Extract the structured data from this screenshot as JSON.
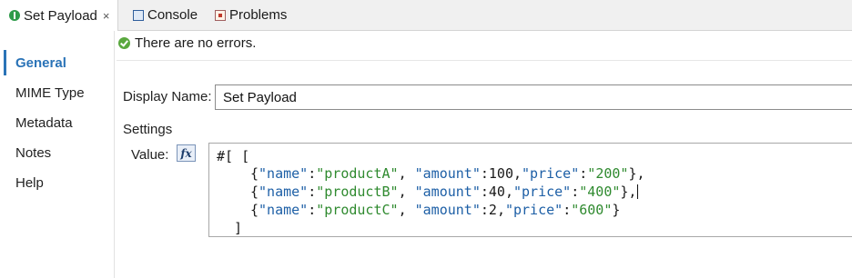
{
  "tabs": [
    {
      "label": "Set Payload",
      "active": true
    },
    {
      "label": "Console"
    },
    {
      "label": "Problems"
    }
  ],
  "close_glyph": "×",
  "sidebar": {
    "items": [
      {
        "label": "General",
        "active": true
      },
      {
        "label": "MIME Type"
      },
      {
        "label": "Metadata"
      },
      {
        "label": "Notes"
      },
      {
        "label": "Help"
      }
    ]
  },
  "status": {
    "message": "There are no errors."
  },
  "form": {
    "display_name_label": "Display Name:",
    "display_name_value": "Set Payload",
    "settings_label": "Settings",
    "value_label": "Value:",
    "fx_label": "fx"
  },
  "code": {
    "prefix": "#[ [",
    "rows": [
      {
        "name": "productA",
        "amount": "100",
        "price": "200",
        "tail": "},"
      },
      {
        "name": "productB",
        "amount": "40",
        "price": "400",
        "tail": "},"
      },
      {
        "name": "productC",
        "amount": "2",
        "price": "600",
        "tail": "}"
      }
    ],
    "close": "]",
    "key_name": "\"name\"",
    "key_amount": "\"amount\"",
    "key_price": "\"price\""
  },
  "colors": {
    "accent": "#2a73b7",
    "string": "#2f8a2f",
    "key": "#1d5fa6",
    "ok": "#5aa83f"
  },
  "icons": {
    "tab_set_payload": "set-payload-icon",
    "tab_console": "console-icon",
    "tab_problems": "problems-icon",
    "status": "check-icon",
    "expression": "fx-icon"
  }
}
